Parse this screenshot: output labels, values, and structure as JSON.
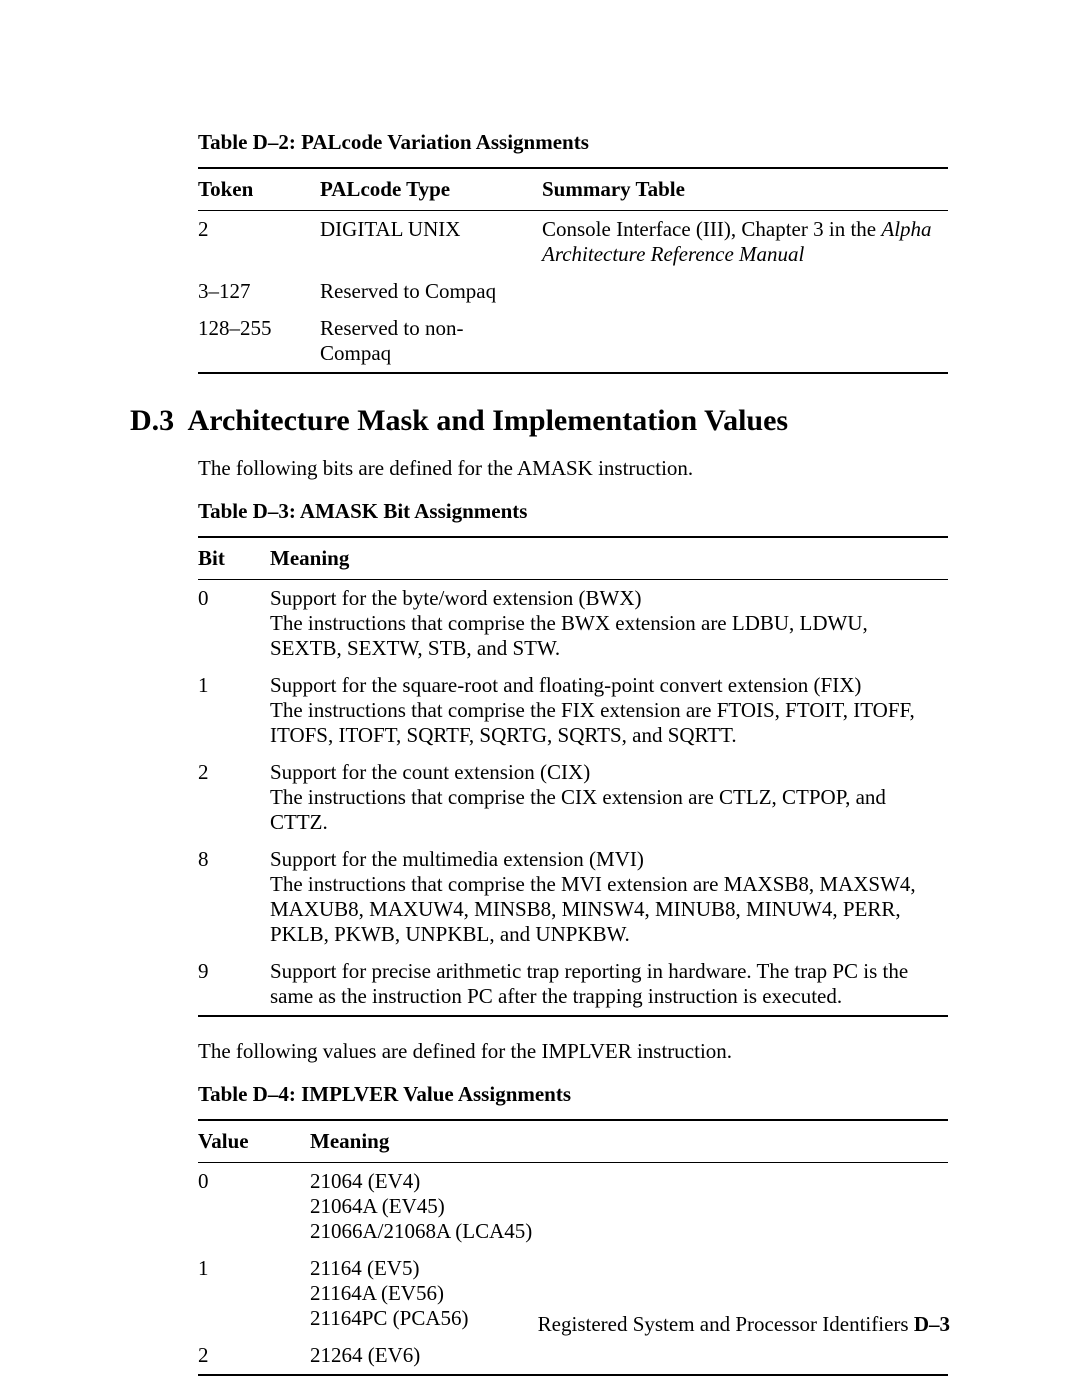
{
  "tableD2": {
    "caption": "Table D–2:   PALcode Variation Assignments",
    "headers": {
      "token": "Token",
      "pal": "PALcode Type",
      "summary": "Summary Table"
    },
    "rows": [
      {
        "token": "2",
        "pal": "DIGITAL UNIX",
        "summary_plain": "Console Interface (III), Chapter 3 in the ",
        "summary_italic": "Alpha Architecture Reference Manual"
      },
      {
        "token": "3–127",
        "pal": "Reserved to Compaq",
        "summary_plain": "",
        "summary_italic": ""
      },
      {
        "token": "128–255",
        "pal": "Reserved to non-Compaq",
        "summary_plain": "",
        "summary_italic": ""
      }
    ]
  },
  "section": {
    "number": "D.3",
    "title": "Architecture Mask and Implementation Values"
  },
  "intro_amask": "The following bits are defined for the AMASK instruction.",
  "tableD3": {
    "caption": "Table D–3:   AMASK Bit Assignments",
    "headers": {
      "bit": "Bit",
      "meaning": "Meaning"
    },
    "rows": [
      {
        "bit": "0",
        "line1": "Support for the byte/word extension (BWX)",
        "line2": "The instructions that comprise the BWX extension are LDBU, LDWU, SEXTB, SEXTW, STB, and STW."
      },
      {
        "bit": "1",
        "line1": "Support for the square-root and floating-point convert extension (FIX)",
        "line2": "The instructions that comprise the FIX extension are FTOIS, FTOIT, ITOFF, ITOFS, ITOFT, SQRTF, SQRTG, SQRTS, and SQRTT."
      },
      {
        "bit": "2",
        "line1": "Support for the count extension (CIX)",
        "line2": "The instructions that comprise the CIX extension are CTLZ, CTPOP, and  CTTZ."
      },
      {
        "bit": "8",
        "line1": "Support for the multimedia extension (MVI)",
        "line2": "The instructions that comprise the MVI extension are MAXSB8, MAXSW4, MAXUB8, MAXUW4, MINSB8, MINSW4, MINUB8, MINUW4, PERR, PKLB, PKWB, UNPKBL, and UNPKBW."
      },
      {
        "bit": "9",
        "line1": "Support for precise arithmetic trap reporting in hardware. The trap PC is the same as the instruction PC after the trapping instruction is executed.",
        "line2": ""
      }
    ]
  },
  "intro_implver": "The following values are defined for the IMPLVER instruction.",
  "tableD4": {
    "caption": "Table D–4:   IMPLVER Value Assignments",
    "headers": {
      "value": "Value",
      "meaning": "Meaning"
    },
    "rows": [
      {
        "value": "0",
        "line1": "21064 (EV4)",
        "line2": "21064A (EV45)",
        "line3": "21066A/21068A (LCA45)"
      },
      {
        "value": "1",
        "line1": "21164 (EV5)",
        "line2": "21164A (EV56)",
        "line3": "21164PC (PCA56)"
      },
      {
        "value": "2",
        "line1": "21264 (EV6)",
        "line2": "",
        "line3": ""
      }
    ]
  },
  "footer": {
    "text": "Registered System and Processor Identifiers ",
    "page": "D–3"
  }
}
